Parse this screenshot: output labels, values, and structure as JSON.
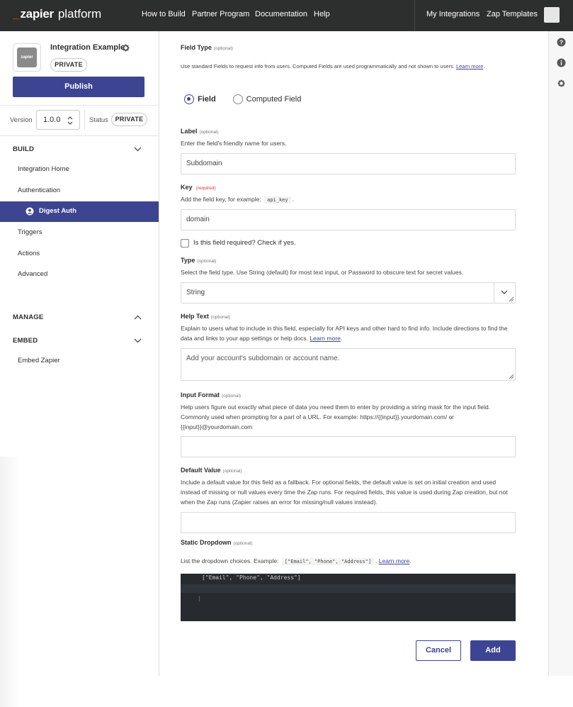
{
  "topbar": {
    "logo_zap": "zapier",
    "logo_platform": "platform",
    "links": [
      "How to Build",
      "Partner Program",
      "Documentation",
      "Help"
    ],
    "right_links": [
      "My Integrations",
      "Zap Templates"
    ]
  },
  "sidebar": {
    "app_icon_text": "zapier",
    "app_name": "Integration Example",
    "private_badge": "PRIVATE",
    "publish_label": "Publish",
    "version_label": "Version",
    "version_value": "1.0.0",
    "status_label": "Status",
    "status_value": "PRIVATE",
    "build_heading": "BUILD",
    "build_items": [
      "Integration Home",
      "Authentication"
    ],
    "active_item": "Digest Auth",
    "build_items_after": [
      "Triggers",
      "Actions",
      "Advanced"
    ],
    "manage_heading": "MANAGE",
    "embed_heading": "EMBED",
    "embed_items": [
      "Embed Zapier"
    ]
  },
  "form": {
    "field_type": {
      "label": "Field Type",
      "optional": "(optional)",
      "desc": "Use standard Fields to request info from users. Computed Fields are used programmatically and not shown to users.",
      "learn_more": "Learn more",
      "options": [
        "Field",
        "Computed Field"
      ],
      "selected": "Field"
    },
    "label_field": {
      "label": "Label",
      "optional": "(optional)",
      "desc": "Enter the field's friendly name for users.",
      "value": "Subdomain"
    },
    "key_field": {
      "label": "Key",
      "required": "(required)",
      "desc_prefix": "Add the field key, for example:",
      "example": "api_key",
      "value": "domain"
    },
    "required_check": "Is this field required? Check if yes.",
    "type_field": {
      "label": "Type",
      "optional": "(optional)",
      "desc": "Select the field type. Use String (default) for most text input, or Password to obscure text for secret values.",
      "value": "String"
    },
    "help_text": {
      "label": "Help Text",
      "optional": "(optional)",
      "desc": "Explain to users what to include in this field, especially for API keys and other hard to find info. Include directions to find the data and links to your app settings or help docs.",
      "learn_more": "Learn more",
      "value": "Add your account's subdomain or account name."
    },
    "input_format": {
      "label": "Input Format",
      "optional": "(optional)",
      "desc": "Help users figure out exactly what piece of data you need them to enter by providing a string mask for the input field. Commonly used when prompting for a part of a URL. For example: https://{{input}}.yourdomain.com/ or {{input}}@yourdomain.com",
      "value": ""
    },
    "default_value": {
      "label": "Default Value",
      "optional": "(optional)",
      "desc": "Include a default value for this field as a fallback. For optional fields, the default value is set on initial creation and used instead of missing or null values every time the Zap runs. For required fields, this value is used during Zap creation, but not when the Zap runs (Zapier raises an error for missing/null values instead).",
      "value": ""
    },
    "static_dropdown": {
      "label": "Static Dropdown",
      "optional": "(optional)",
      "desc_prefix": "List the dropdown choices. Example:",
      "example": "[\"Email\", \"Phone\", \"Address\"]",
      "learn_more": "Learn more",
      "code_line": "[\"Email\", \"Phone\", \"Address\"]",
      "code_line2": "]"
    },
    "cancel_label": "Cancel",
    "add_label": "Add"
  },
  "colors": {
    "brand_orange": "#ff4f00",
    "accent": "#3d4592",
    "topbar": "#2d2e2e"
  }
}
